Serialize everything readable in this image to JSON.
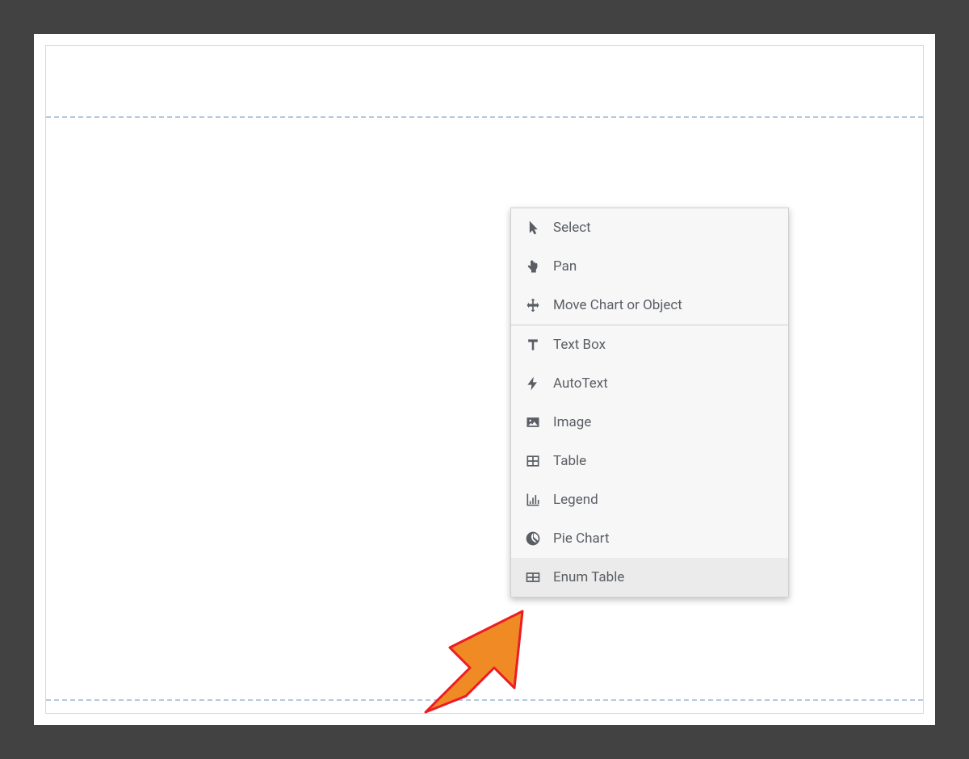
{
  "context_menu": {
    "groups": [
      {
        "items": [
          {
            "id": "select",
            "label": "Select",
            "icon": "cursor-icon"
          },
          {
            "id": "pan",
            "label": "Pan",
            "icon": "hand-pointer-icon"
          },
          {
            "id": "move-chart-object",
            "label": "Move Chart or Object",
            "icon": "move-icon"
          }
        ]
      },
      {
        "items": [
          {
            "id": "text-box",
            "label": "Text Box",
            "icon": "text-icon"
          },
          {
            "id": "autotext",
            "label": "AutoText",
            "icon": "lightning-icon"
          },
          {
            "id": "image",
            "label": "Image",
            "icon": "image-icon"
          },
          {
            "id": "table",
            "label": "Table",
            "icon": "table-icon"
          },
          {
            "id": "legend",
            "label": "Legend",
            "icon": "bar-chart-icon"
          },
          {
            "id": "pie-chart",
            "label": "Pie Chart",
            "icon": "pie-chart-icon"
          },
          {
            "id": "enum-table",
            "label": "Enum Table",
            "icon": "table-wide-icon",
            "highlighted": true
          }
        ]
      }
    ]
  },
  "annotation": {
    "arrow_color_fill": "#f08a24",
    "arrow_color_stroke": "#ed1c24"
  }
}
